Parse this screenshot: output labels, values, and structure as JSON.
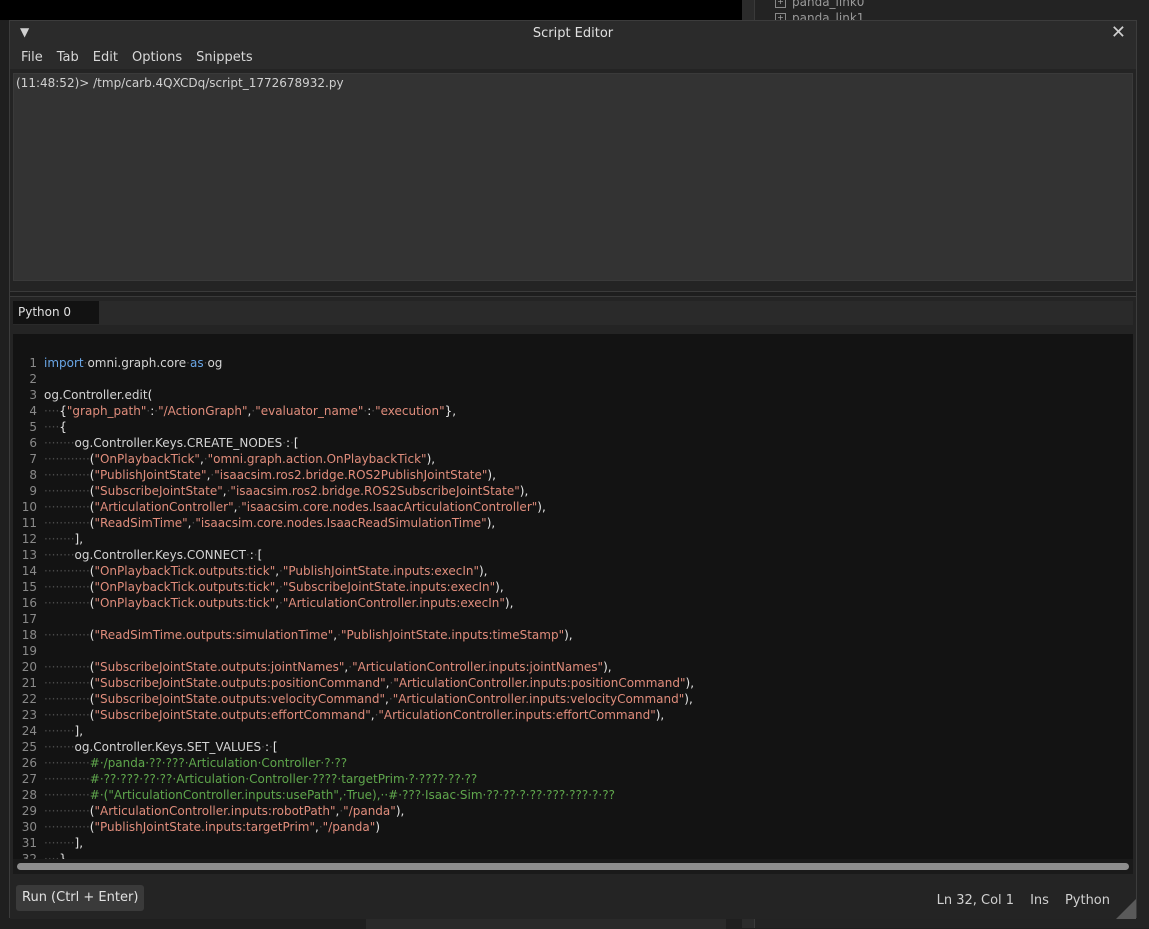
{
  "background": {
    "tree_items": [
      "panda_link0",
      "panda_link1"
    ]
  },
  "window": {
    "title": "Script Editor",
    "collapse_glyph": "▼",
    "close_glyph": "✕"
  },
  "menu": [
    "File",
    "Tab",
    "Edit",
    "Options",
    "Snippets"
  ],
  "output": {
    "text": "(11:48:52)> /tmp/carb.4QXCDq/script_1772678932.py"
  },
  "tabs": [
    {
      "label": "Python 0",
      "active": true
    }
  ],
  "editor": {
    "lines": [
      [
        [
          "k",
          "import"
        ],
        [
          "ws",
          "·"
        ],
        [
          "n",
          "omni.graph.core"
        ],
        [
          "ws",
          "·"
        ],
        [
          "k",
          "as"
        ],
        [
          "ws",
          "·"
        ],
        [
          "n",
          "og"
        ]
      ],
      [],
      [
        [
          "n",
          "og.Controller.edit"
        ],
        [
          "p",
          "("
        ]
      ],
      [
        [
          "ws",
          "····"
        ],
        [
          "p",
          "{"
        ],
        [
          "s",
          "\"graph_path\""
        ],
        [
          "ws",
          "·"
        ],
        [
          "p",
          ":"
        ],
        [
          "ws",
          "·"
        ],
        [
          "s",
          "\"/ActionGraph\""
        ],
        [
          "p",
          ","
        ],
        [
          "ws",
          "·"
        ],
        [
          "s",
          "\"evaluator_name\""
        ],
        [
          "ws",
          "·"
        ],
        [
          "p",
          ":"
        ],
        [
          "ws",
          "·"
        ],
        [
          "s",
          "\"execution\""
        ],
        [
          "p",
          "},"
        ]
      ],
      [
        [
          "ws",
          "····"
        ],
        [
          "p",
          "{"
        ]
      ],
      [
        [
          "ws",
          "········"
        ],
        [
          "n",
          "og.Controller.Keys.CREATE_NODES"
        ],
        [
          "ws",
          "·"
        ],
        [
          "p",
          ":"
        ],
        [
          "ws",
          "·"
        ],
        [
          "p",
          "["
        ]
      ],
      [
        [
          "ws",
          "············"
        ],
        [
          "p",
          "("
        ],
        [
          "s",
          "\"OnPlaybackTick\""
        ],
        [
          "p",
          ","
        ],
        [
          "ws",
          "·"
        ],
        [
          "s",
          "\"omni.graph.action.OnPlaybackTick\""
        ],
        [
          "p",
          "),"
        ]
      ],
      [
        [
          "ws",
          "············"
        ],
        [
          "p",
          "("
        ],
        [
          "s",
          "\"PublishJointState\""
        ],
        [
          "p",
          ","
        ],
        [
          "ws",
          "·"
        ],
        [
          "s",
          "\"isaacsim.ros2.bridge.ROS2PublishJointState\""
        ],
        [
          "p",
          "),"
        ]
      ],
      [
        [
          "ws",
          "············"
        ],
        [
          "p",
          "("
        ],
        [
          "s",
          "\"SubscribeJointState\""
        ],
        [
          "p",
          ","
        ],
        [
          "ws",
          "·"
        ],
        [
          "s",
          "\"isaacsim.ros2.bridge.ROS2SubscribeJointState\""
        ],
        [
          "p",
          "),"
        ]
      ],
      [
        [
          "ws",
          "············"
        ],
        [
          "p",
          "("
        ],
        [
          "s",
          "\"ArticulationController\""
        ],
        [
          "p",
          ","
        ],
        [
          "ws",
          "·"
        ],
        [
          "s",
          "\"isaacsim.core.nodes.IsaacArticulationController\""
        ],
        [
          "p",
          "),"
        ]
      ],
      [
        [
          "ws",
          "············"
        ],
        [
          "p",
          "("
        ],
        [
          "s",
          "\"ReadSimTime\""
        ],
        [
          "p",
          ","
        ],
        [
          "ws",
          "·"
        ],
        [
          "s",
          "\"isaacsim.core.nodes.IsaacReadSimulationTime\""
        ],
        [
          "p",
          "),"
        ]
      ],
      [
        [
          "ws",
          "········"
        ],
        [
          "p",
          "],"
        ]
      ],
      [
        [
          "ws",
          "········"
        ],
        [
          "n",
          "og.Controller.Keys.CONNECT"
        ],
        [
          "ws",
          "·"
        ],
        [
          "p",
          ":"
        ],
        [
          "ws",
          "·"
        ],
        [
          "p",
          "["
        ]
      ],
      [
        [
          "ws",
          "············"
        ],
        [
          "p",
          "("
        ],
        [
          "s",
          "\"OnPlaybackTick.outputs:tick\""
        ],
        [
          "p",
          ","
        ],
        [
          "ws",
          "·"
        ],
        [
          "s",
          "\"PublishJointState.inputs:execIn\""
        ],
        [
          "p",
          "),"
        ]
      ],
      [
        [
          "ws",
          "············"
        ],
        [
          "p",
          "("
        ],
        [
          "s",
          "\"OnPlaybackTick.outputs:tick\""
        ],
        [
          "p",
          ","
        ],
        [
          "ws",
          "·"
        ],
        [
          "s",
          "\"SubscribeJointState.inputs:execIn\""
        ],
        [
          "p",
          "),"
        ]
      ],
      [
        [
          "ws",
          "············"
        ],
        [
          "p",
          "("
        ],
        [
          "s",
          "\"OnPlaybackTick.outputs:tick\""
        ],
        [
          "p",
          ","
        ],
        [
          "ws",
          "·"
        ],
        [
          "s",
          "\"ArticulationController.inputs:execIn\""
        ],
        [
          "p",
          "),"
        ]
      ],
      [],
      [
        [
          "ws",
          "············"
        ],
        [
          "p",
          "("
        ],
        [
          "s",
          "\"ReadSimTime.outputs:simulationTime\""
        ],
        [
          "p",
          ","
        ],
        [
          "ws",
          "·"
        ],
        [
          "s",
          "\"PublishJointState.inputs:timeStamp\""
        ],
        [
          "p",
          "),"
        ]
      ],
      [],
      [
        [
          "ws",
          "············"
        ],
        [
          "p",
          "("
        ],
        [
          "s",
          "\"SubscribeJointState.outputs:jointNames\""
        ],
        [
          "p",
          ","
        ],
        [
          "ws",
          "·"
        ],
        [
          "s",
          "\"ArticulationController.inputs:jointNames\""
        ],
        [
          "p",
          "),"
        ]
      ],
      [
        [
          "ws",
          "············"
        ],
        [
          "p",
          "("
        ],
        [
          "s",
          "\"SubscribeJointState.outputs:positionCommand\""
        ],
        [
          "p",
          ","
        ],
        [
          "ws",
          "·"
        ],
        [
          "s",
          "\"ArticulationController.inputs:positionCommand\""
        ],
        [
          "p",
          "),"
        ]
      ],
      [
        [
          "ws",
          "············"
        ],
        [
          "p",
          "("
        ],
        [
          "s",
          "\"SubscribeJointState.outputs:velocityCommand\""
        ],
        [
          "p",
          ","
        ],
        [
          "ws",
          "·"
        ],
        [
          "s",
          "\"ArticulationController.inputs:velocityCommand\""
        ],
        [
          "p",
          "),"
        ]
      ],
      [
        [
          "ws",
          "············"
        ],
        [
          "p",
          "("
        ],
        [
          "s",
          "\"SubscribeJointState.outputs:effortCommand\""
        ],
        [
          "p",
          ","
        ],
        [
          "ws",
          "·"
        ],
        [
          "s",
          "\"ArticulationController.inputs:effortCommand\""
        ],
        [
          "p",
          "),"
        ]
      ],
      [
        [
          "ws",
          "········"
        ],
        [
          "p",
          "],"
        ]
      ],
      [
        [
          "ws",
          "········"
        ],
        [
          "n",
          "og.Controller.Keys.SET_VALUES"
        ],
        [
          "ws",
          "·"
        ],
        [
          "p",
          ":"
        ],
        [
          "ws",
          "·"
        ],
        [
          "p",
          "["
        ]
      ],
      [
        [
          "ws",
          "············"
        ],
        [
          "c",
          "#·/panda·??·???·Articulation·Controller·?·??"
        ]
      ],
      [
        [
          "ws",
          "············"
        ],
        [
          "c",
          "#·??·???·??·??·Articulation·Controller·????·targetPrim·?·????·??·??"
        ]
      ],
      [
        [
          "ws",
          "············"
        ],
        [
          "c",
          "#·(\"ArticulationController.inputs:usePath\",·True),··#·???·Isaac·Sim·??·??·?·??·???·???·?·??"
        ]
      ],
      [
        [
          "ws",
          "············"
        ],
        [
          "p",
          "("
        ],
        [
          "s",
          "\"ArticulationController.inputs:robotPath\""
        ],
        [
          "p",
          ","
        ],
        [
          "ws",
          "·"
        ],
        [
          "s",
          "\"/panda\""
        ],
        [
          "p",
          "),"
        ]
      ],
      [
        [
          "ws",
          "············"
        ],
        [
          "p",
          "("
        ],
        [
          "s",
          "\"PublishJointState.inputs:targetPrim\""
        ],
        [
          "p",
          ","
        ],
        [
          "ws",
          "·"
        ],
        [
          "s",
          "\"/panda\""
        ],
        [
          "p",
          ")"
        ]
      ],
      [
        [
          "ws",
          "········"
        ],
        [
          "p",
          "],"
        ]
      ],
      [
        [
          "ws",
          "····"
        ],
        [
          "p",
          "},"
        ]
      ],
      [
        [
          "p",
          ")"
        ]
      ]
    ]
  },
  "footer": {
    "run_label": "Run (Ctrl + Enter)",
    "cursor_pos": "Ln 32, Col 1",
    "mode": "Ins",
    "language": "Python"
  }
}
